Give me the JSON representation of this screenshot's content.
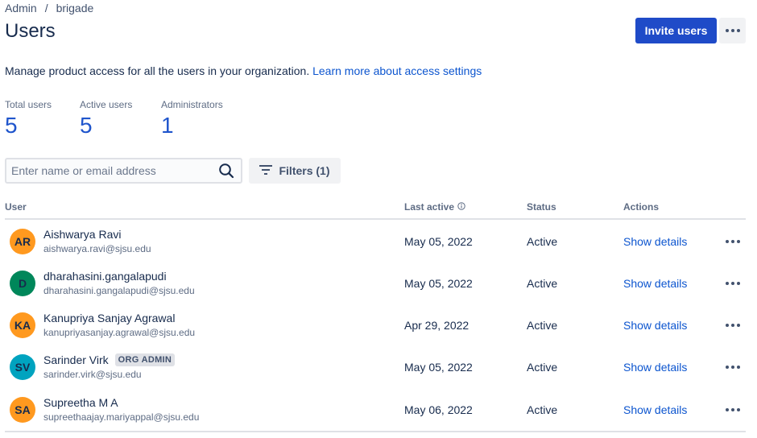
{
  "breadcrumb": {
    "root": "Admin",
    "separator": "/",
    "current": "brigade"
  },
  "page_title": "Users",
  "header": {
    "invite_label": "Invite users",
    "more_icon": "more-horizontal-icon"
  },
  "description": {
    "text": "Manage product access for all the users in your organization. ",
    "link": "Learn more about access settings"
  },
  "stats": [
    {
      "label": "Total users",
      "value": "5"
    },
    {
      "label": "Active users",
      "value": "5"
    },
    {
      "label": "Administrators",
      "value": "1"
    }
  ],
  "search": {
    "placeholder": "Enter name or email address",
    "value": "",
    "icon": "search-icon"
  },
  "filters": {
    "label": "Filters (1)",
    "icon": "filter-icon"
  },
  "table": {
    "columns": {
      "user": "User",
      "last_active": "Last active",
      "status": "Status",
      "actions": "Actions"
    },
    "action_label": "Show details",
    "rows": [
      {
        "initials": "AR",
        "avatar_color": "#ff991f",
        "name": "Aishwarya Ravi",
        "badge": "",
        "email": "aishwarya.ravi@sjsu.edu",
        "last_active": "May 05, 2022",
        "status": "Active"
      },
      {
        "initials": "D",
        "avatar_color": "#00875a",
        "name": "dharahasini.gangalapudi",
        "badge": "",
        "email": "dharahasini.gangalapudi@sjsu.edu",
        "last_active": "May 05, 2022",
        "status": "Active"
      },
      {
        "initials": "KA",
        "avatar_color": "#ff991f",
        "name": "Kanupriya Sanjay Agrawal",
        "badge": "",
        "email": "kanupriyasanjay.agrawal@sjsu.edu",
        "last_active": "Apr 29, 2022",
        "status": "Active"
      },
      {
        "initials": "SV",
        "avatar_color": "#00a3bf",
        "name": "Sarinder Virk",
        "badge": "ORG ADMIN",
        "email": "sarinder.virk@sjsu.edu",
        "last_active": "May 05, 2022",
        "status": "Active"
      },
      {
        "initials": "SA",
        "avatar_color": "#ff991f",
        "name": "Supreetha M A",
        "badge": "",
        "email": "supreethaajay.mariyappal@sjsu.edu",
        "last_active": "May 06, 2022",
        "status": "Active"
      }
    ]
  },
  "colors": {
    "primary": "#1f4bc8",
    "link": "#0c55cf",
    "stat_number": "#1f55cc"
  }
}
